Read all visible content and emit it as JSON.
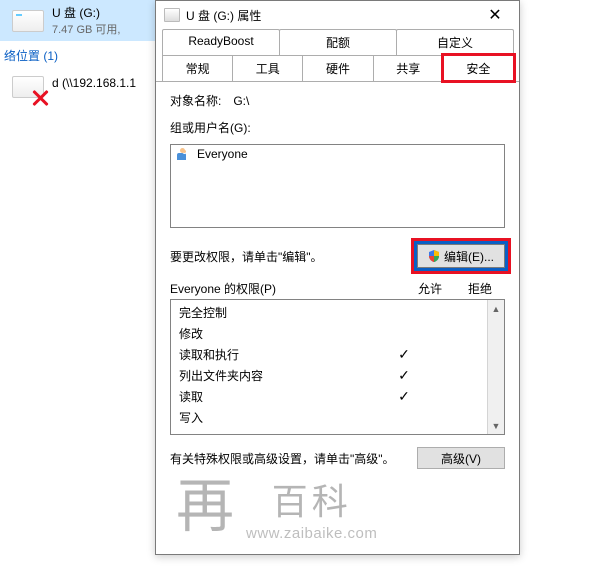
{
  "explorer": {
    "drive": {
      "title": "U 盘 (G:)",
      "sub": "7.47 GB 可用, "
    },
    "location_header": "络位置 (1)",
    "netdrive": {
      "label": "d (\\\\192.168.1.1"
    }
  },
  "dialog": {
    "title": "U 盘 (G:) 属性",
    "close": "✕",
    "tabs_top": [
      "ReadyBoost",
      "配额",
      "自定义"
    ],
    "tabs_bottom": [
      "常规",
      "工具",
      "硬件",
      "共享",
      "安全"
    ],
    "object_label": "对象名称:",
    "object_value": "G:\\",
    "group_label": "组或用户名(G):",
    "users": [
      "Everyone"
    ],
    "edit_hint": "要更改权限，请单击\"编辑\"。",
    "edit_button": "编辑(E)...",
    "perm_header": "Everyone 的权限(P)",
    "col_allow": "允许",
    "col_deny": "拒绝",
    "permissions": [
      {
        "name": "完全控制",
        "allow": false,
        "deny": false
      },
      {
        "name": "修改",
        "allow": false,
        "deny": false
      },
      {
        "name": "读取和执行",
        "allow": true,
        "deny": false
      },
      {
        "name": "列出文件夹内容",
        "allow": true,
        "deny": false
      },
      {
        "name": "读取",
        "allow": true,
        "deny": false
      },
      {
        "name": "写入",
        "allow": false,
        "deny": false
      }
    ],
    "adv_hint": "有关特殊权限或高级设置，请单击\"高级\"。",
    "adv_button": "高级(V)"
  },
  "watermark": {
    "logo": "再",
    "cn": "百科",
    "url": "www.zaibaike.com"
  }
}
